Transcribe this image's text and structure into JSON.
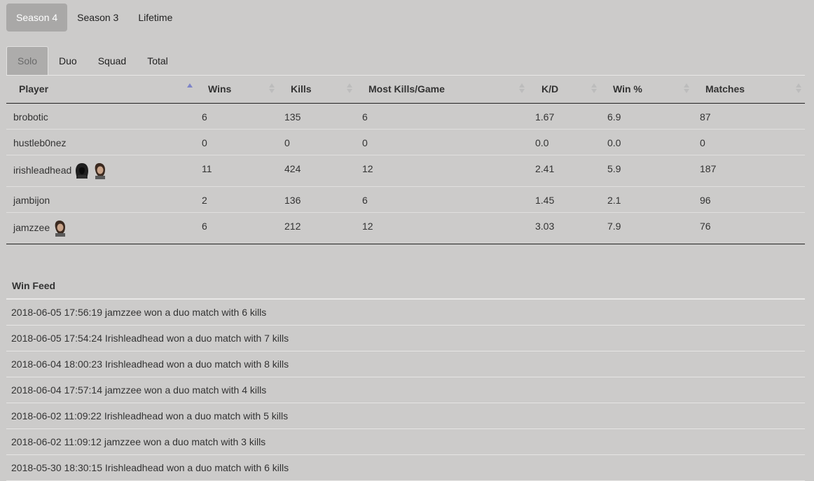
{
  "season_tabs": [
    "Season 4",
    "Season 3",
    "Lifetime"
  ],
  "mode_tabs": [
    "Solo",
    "Duo",
    "Squad",
    "Total"
  ],
  "table": {
    "headers": [
      "Player",
      "Wins",
      "Kills",
      "Most Kills/Game",
      "K/D",
      "Win %",
      "Matches"
    ],
    "rows": [
      {
        "player": "brobotic",
        "wins": "6",
        "kills": "135",
        "most": "6",
        "kd": "1.67",
        "winpct": "6.9",
        "matches": "87",
        "avatars": []
      },
      {
        "player": "hustleb0nez",
        "wins": "0",
        "kills": "0",
        "most": "0",
        "kd": "0.0",
        "winpct": "0.0",
        "matches": "0",
        "avatars": []
      },
      {
        "player": "irishleadhead",
        "wins": "11",
        "kills": "424",
        "most": "12",
        "kd": "2.41",
        "winpct": "5.9",
        "matches": "187",
        "avatars": [
          "hooded-avatar-icon",
          "bearded-avatar-icon"
        ]
      },
      {
        "player": "jambijon",
        "wins": "2",
        "kills": "136",
        "most": "6",
        "kd": "1.45",
        "winpct": "2.1",
        "matches": "96",
        "avatars": []
      },
      {
        "player": "jamzzee",
        "wins": "6",
        "kills": "212",
        "most": "12",
        "kd": "3.03",
        "winpct": "7.9",
        "matches": "76",
        "avatars": [
          "bearded-avatar-icon"
        ]
      }
    ]
  },
  "win_feed": {
    "title": "Win Feed",
    "items": [
      "2018-06-05 17:56:19 jamzzee won a duo match with 6 kills",
      "2018-06-05 17:54:24 Irishleadhead won a duo match with 7 kills",
      "2018-06-04 18:00:23 Irishleadhead won a duo match with 8 kills",
      "2018-06-04 17:57:14 jamzzee won a duo match with 4 kills",
      "2018-06-02 11:09:22 Irishleadhead won a duo match with 5 kills",
      "2018-06-02 11:09:12 jamzzee won a duo match with 3 kills",
      "2018-05-30 18:30:15 Irishleadhead won a duo match with 6 kills"
    ]
  },
  "colors": {
    "background": "#cccbca",
    "active_tab": "#a9a8a7",
    "sort_active": "#7e85c8"
  }
}
